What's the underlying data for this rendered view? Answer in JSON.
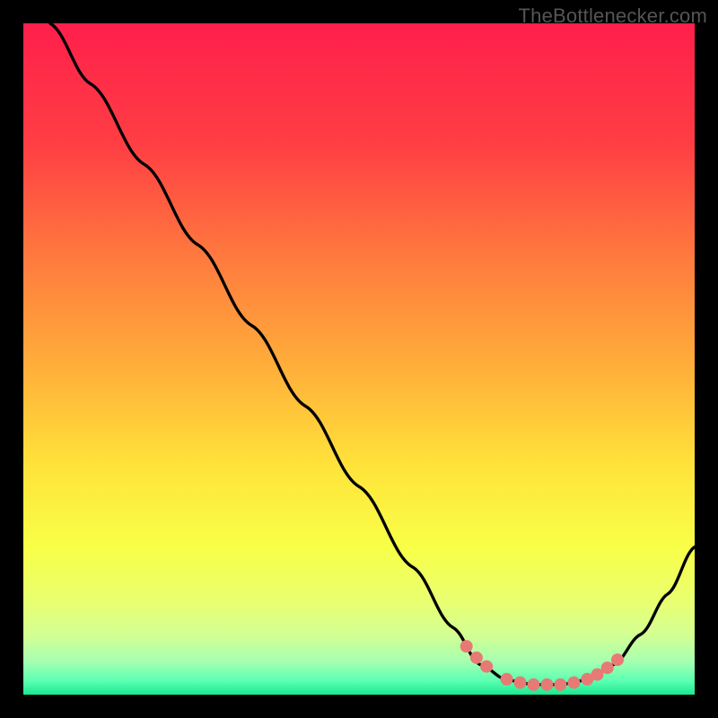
{
  "watermark": "TheBottlenecker.com",
  "chart_data": {
    "type": "line",
    "title": "",
    "xlabel": "",
    "ylabel": "",
    "xlim": [
      0,
      100
    ],
    "ylim": [
      0,
      100
    ],
    "curve": [
      {
        "x": 4,
        "y": 100
      },
      {
        "x": 10,
        "y": 91
      },
      {
        "x": 18,
        "y": 79
      },
      {
        "x": 26,
        "y": 67
      },
      {
        "x": 34,
        "y": 55
      },
      {
        "x": 42,
        "y": 43
      },
      {
        "x": 50,
        "y": 31
      },
      {
        "x": 58,
        "y": 19
      },
      {
        "x": 64,
        "y": 10
      },
      {
        "x": 68,
        "y": 4.5
      },
      {
        "x": 72,
        "y": 2.2
      },
      {
        "x": 76,
        "y": 1.5
      },
      {
        "x": 80,
        "y": 1.5
      },
      {
        "x": 84,
        "y": 2.2
      },
      {
        "x": 88,
        "y": 4.5
      },
      {
        "x": 92,
        "y": 9
      },
      {
        "x": 96,
        "y": 15
      },
      {
        "x": 100,
        "y": 22
      }
    ],
    "markers": [
      {
        "x": 66,
        "y": 7.2
      },
      {
        "x": 67.5,
        "y": 5.5
      },
      {
        "x": 69,
        "y": 4.2
      },
      {
        "x": 72,
        "y": 2.3
      },
      {
        "x": 74,
        "y": 1.8
      },
      {
        "x": 76,
        "y": 1.5
      },
      {
        "x": 78,
        "y": 1.5
      },
      {
        "x": 80,
        "y": 1.5
      },
      {
        "x": 82,
        "y": 1.8
      },
      {
        "x": 84,
        "y": 2.3
      },
      {
        "x": 85.5,
        "y": 3.0
      },
      {
        "x": 87,
        "y": 4.0
      },
      {
        "x": 88.5,
        "y": 5.2
      }
    ],
    "gradient_stops": [
      {
        "offset": 0,
        "color": "#ff1f4b"
      },
      {
        "offset": 18,
        "color": "#ff3e44"
      },
      {
        "offset": 35,
        "color": "#ff7a3e"
      },
      {
        "offset": 52,
        "color": "#ffb13a"
      },
      {
        "offset": 66,
        "color": "#ffe33a"
      },
      {
        "offset": 78,
        "color": "#f8ff47"
      },
      {
        "offset": 86,
        "color": "#e9ff70"
      },
      {
        "offset": 91,
        "color": "#d4ff92"
      },
      {
        "offset": 95,
        "color": "#a7ffb0"
      },
      {
        "offset": 98,
        "color": "#5affb2"
      },
      {
        "offset": 100,
        "color": "#19e98f"
      }
    ],
    "curve_color": "#000000",
    "marker_color": "#e77a74",
    "marker_radius_px": 7
  }
}
